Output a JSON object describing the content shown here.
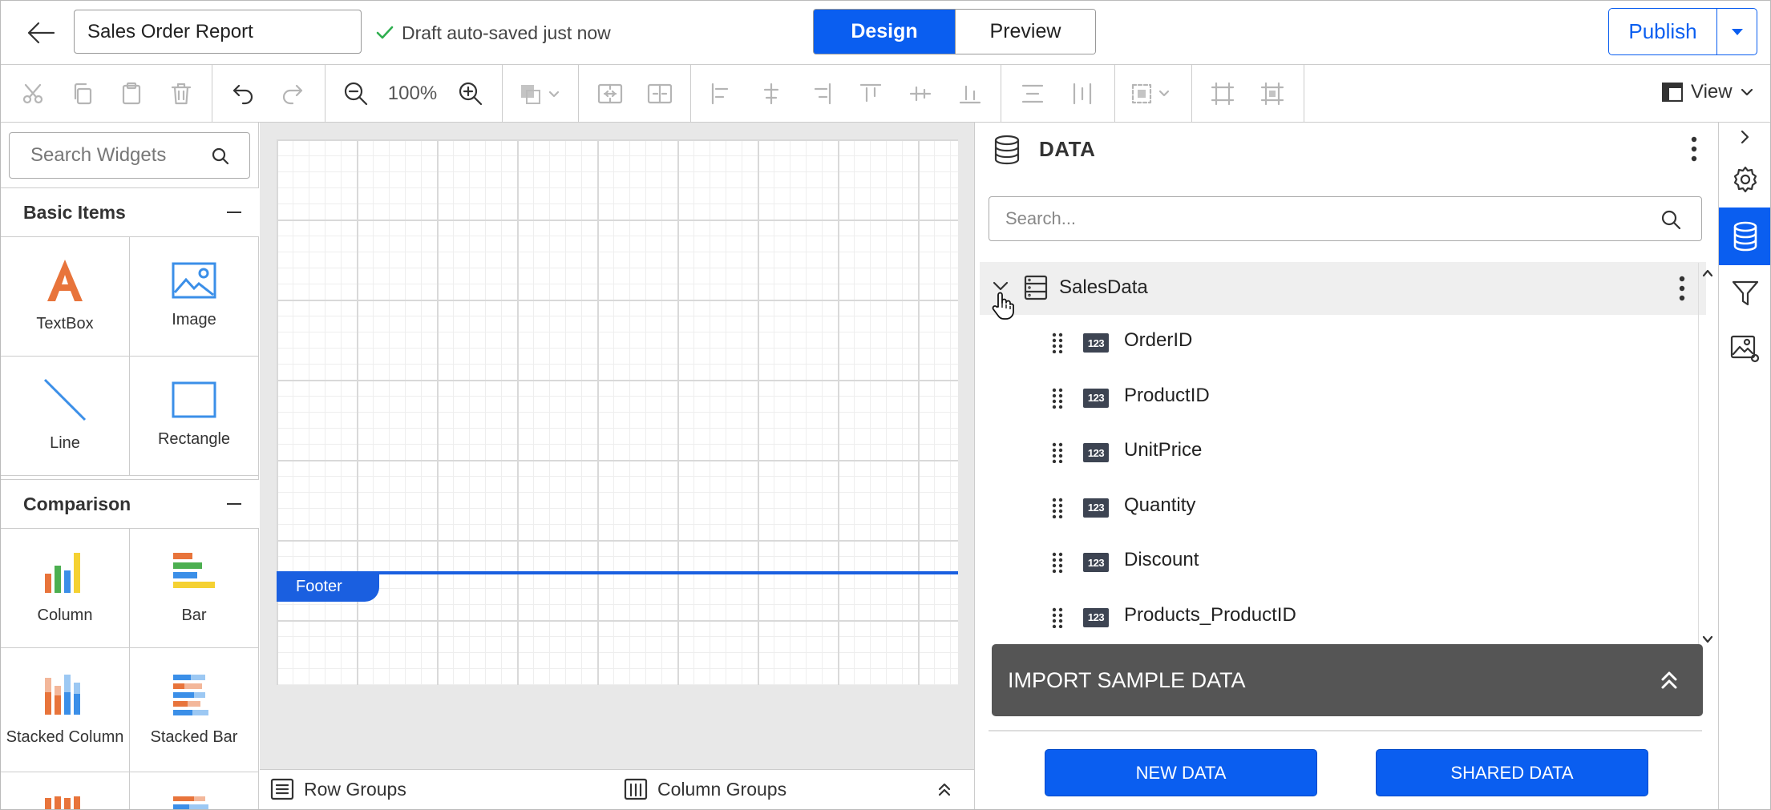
{
  "header": {
    "report_title": "Sales Order Report",
    "saved_status": "Draft auto-saved just now",
    "design_label": "Design",
    "preview_label": "Preview",
    "publish_label": "Publish"
  },
  "toolbar": {
    "zoom": "100%",
    "view_label": "View"
  },
  "widgets": {
    "search_placeholder": "Search Widgets",
    "categories": [
      {
        "label": "Basic Items",
        "items": [
          "TextBox",
          "Image",
          "Line",
          "Rectangle"
        ]
      },
      {
        "label": "Comparison",
        "items": [
          "Column",
          "Bar",
          "Stacked Column",
          "Stacked Bar"
        ]
      }
    ]
  },
  "canvas": {
    "footer_label": "Footer",
    "row_groups_label": "Row Groups",
    "column_groups_label": "Column Groups"
  },
  "data_panel": {
    "title": "DATA",
    "search_placeholder": "Search...",
    "dataset_name": "SalesData",
    "field_type_badge": "123",
    "fields": [
      "OrderID",
      "ProductID",
      "UnitPrice",
      "Quantity",
      "Discount",
      "Products_ProductID"
    ],
    "import_label": "IMPORT SAMPLE DATA",
    "new_data_label": "NEW DATA",
    "shared_data_label": "SHARED DATA"
  },
  "colors": {
    "accent": "#0a5ef0",
    "import_bar": "#555555",
    "field_badge": "#3d4452",
    "textbox_icon": "#e8743b",
    "image_icon": "#3b8fe8"
  },
  "icons": [
    "back-arrow-icon",
    "check-icon",
    "chevron-down-icon",
    "cut-icon",
    "copy-icon",
    "paste-icon",
    "delete-icon",
    "undo-icon",
    "redo-icon",
    "zoom-out-icon",
    "zoom-in-icon",
    "search-icon",
    "database-icon",
    "settings-icon",
    "filter-icon",
    "image-settings-icon",
    "more-vertical-icon",
    "drag-grip-icon",
    "double-chevron-up-icon"
  ]
}
